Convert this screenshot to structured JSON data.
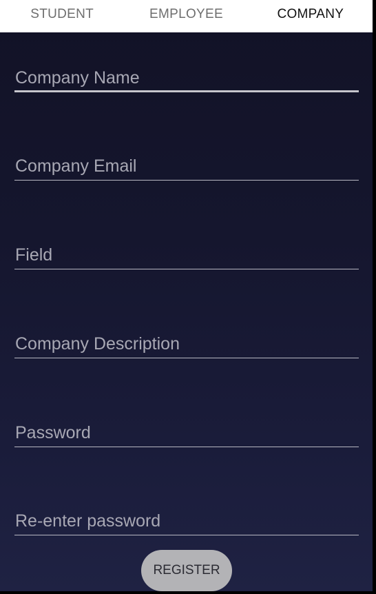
{
  "tabs": [
    {
      "label": "STUDENT",
      "active": false
    },
    {
      "label": "EMPLOYEE",
      "active": false
    },
    {
      "label": "COMPANY",
      "active": true
    }
  ],
  "form": {
    "fields": [
      {
        "label": "Company Name",
        "value": "",
        "focused": true
      },
      {
        "label": "Company Email",
        "value": "",
        "focused": false
      },
      {
        "label": "Field",
        "value": "",
        "focused": false
      },
      {
        "label": "Company Description",
        "value": "",
        "focused": false
      },
      {
        "label": "Password",
        "value": "",
        "focused": false
      },
      {
        "label": "Re-enter password",
        "value": "",
        "focused": false
      }
    ],
    "register_label": "REGISTER"
  },
  "colors": {
    "background_top": "#121226",
    "background_bottom": "#1f2243",
    "tab_active": "#111111",
    "tab_inactive": "#6e6e6e",
    "field_hint": "#a8a8b4",
    "button_bg": "#b3b3b6"
  }
}
